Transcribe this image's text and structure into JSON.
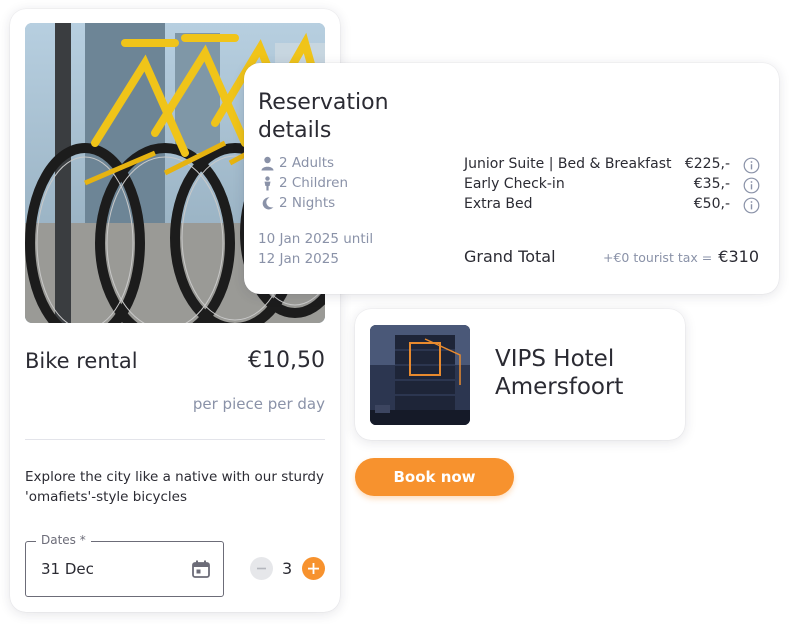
{
  "bike_card": {
    "title": "Bike rental",
    "price": "€10,50",
    "unit": "per piece per day",
    "description": "Explore the city like a native with our sturdy 'omafiets'-style bicycles",
    "dates": {
      "label": "Dates *",
      "value": "31 Dec"
    },
    "quantity": "3"
  },
  "reservation": {
    "title_line1": "Reservation",
    "title_line2": "details",
    "guests": {
      "adults": "2 Adults",
      "children": "2 Children",
      "nights": "2 Nights"
    },
    "date_line1": "10 Jan 2025 until",
    "date_line2": "12 Jan 2025",
    "line_items": [
      {
        "name": "Junior Suite | Bed & Breakfast",
        "price": "€225,-"
      },
      {
        "name": "Early Check-in",
        "price": "€35,-"
      },
      {
        "name": "Extra Bed",
        "price": "€50,-"
      }
    ],
    "grand_total_label": "Grand Total",
    "tax_note": "+€0 tourist tax =",
    "grand_total": "€310"
  },
  "hotel": {
    "name_line1": "VIPS Hotel",
    "name_line2": "Amersfoort"
  },
  "book_button": "Book now",
  "colors": {
    "accent": "#f7922e",
    "muted_text": "#8a92a8",
    "text": "#2b2b33"
  },
  "icons": {
    "adults": "person-icon",
    "children": "child-icon",
    "nights": "moon-icon",
    "info": "info-icon",
    "calendar": "calendar-icon",
    "minus": "minus-icon",
    "plus": "plus-icon"
  }
}
